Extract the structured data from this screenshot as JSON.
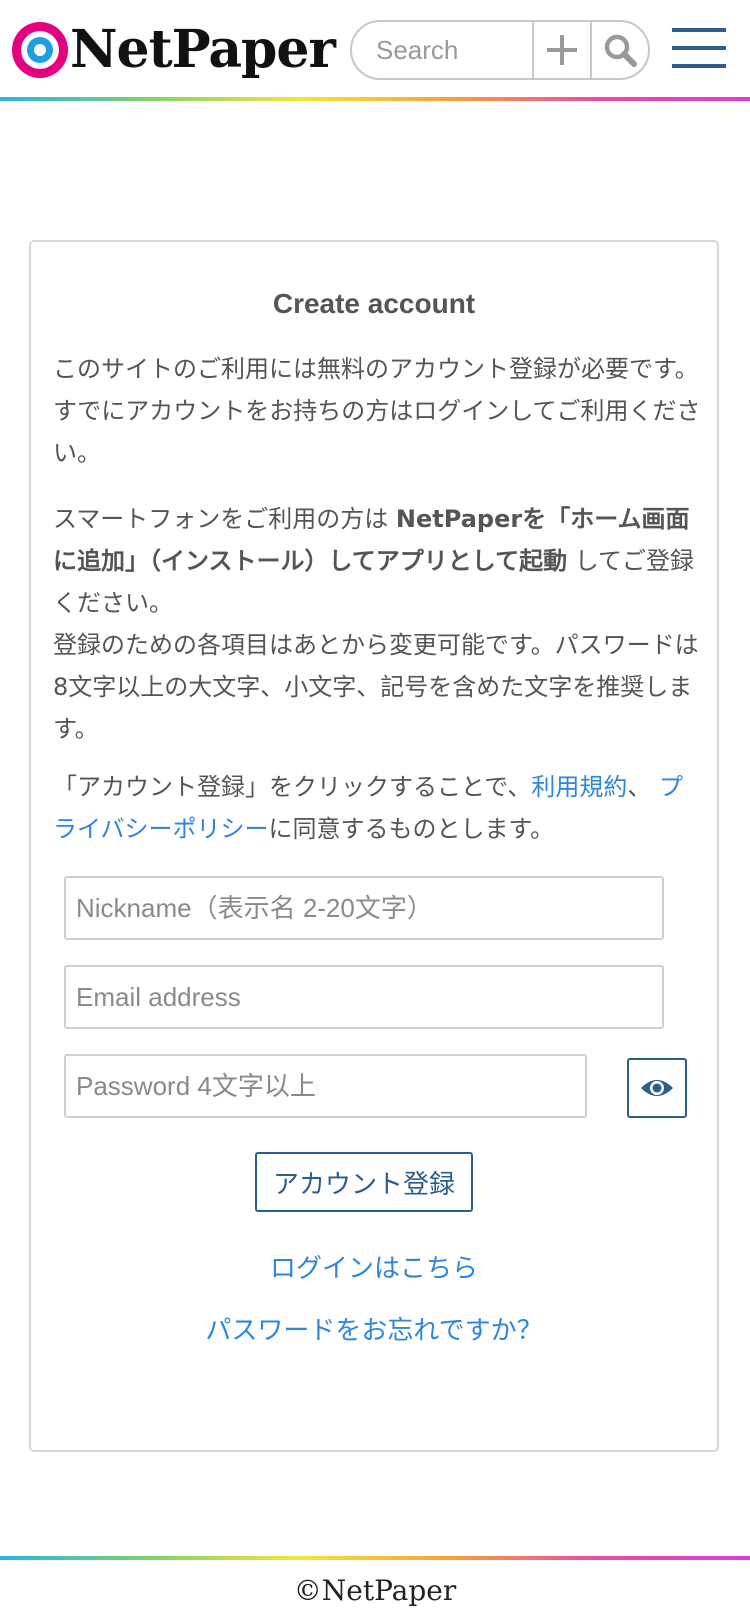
{
  "header": {
    "logo_text": "NetPaper",
    "search_placeholder": "Search",
    "add_icon": "plus-icon",
    "search_icon": "magnifier-icon",
    "menu_icon": "hamburger-icon"
  },
  "card": {
    "title": "Create account",
    "intro": "このサイトのご利用には無料のアカウント登録が必要です。すでにアカウントをお持ちの方はログインしてご利用ください。",
    "smartphone_pre": "スマートフォンをご利用の方は ",
    "smartphone_bold": "NetPaperを「ホーム画面に追加」（インストール）してアプリとして起動",
    "smartphone_post": " してご登録ください。",
    "items_note": "登録のための各項目はあとから変更可能です。パスワードは8文字以上の大文字、小文字、記号を含めた文字を推奨します。",
    "agree_pre": "「アカウント登録」をクリックすることで、",
    "terms_link": "利用規約",
    "agree_sep": "、 ",
    "privacy_link": "プライバシーポリシー",
    "agree_post": "に同意するものとします。",
    "nickname_placeholder": "Nickname（表示名 2-20文字）",
    "email_placeholder": "Email address",
    "password_placeholder": "Password 4文字以上",
    "eye_icon": "eye-icon",
    "submit_label": "アカウント登録",
    "login_link": "ログインはこちら",
    "forgot_link": "パスワードをお忘れですか？"
  },
  "footer": {
    "copyright": "©NetPaper"
  },
  "colors": {
    "brand_magenta": "#e4007f",
    "brand_blue": "#1e9fe0",
    "button_navy": "#2d5d8f",
    "link_blue": "#2e86de"
  }
}
